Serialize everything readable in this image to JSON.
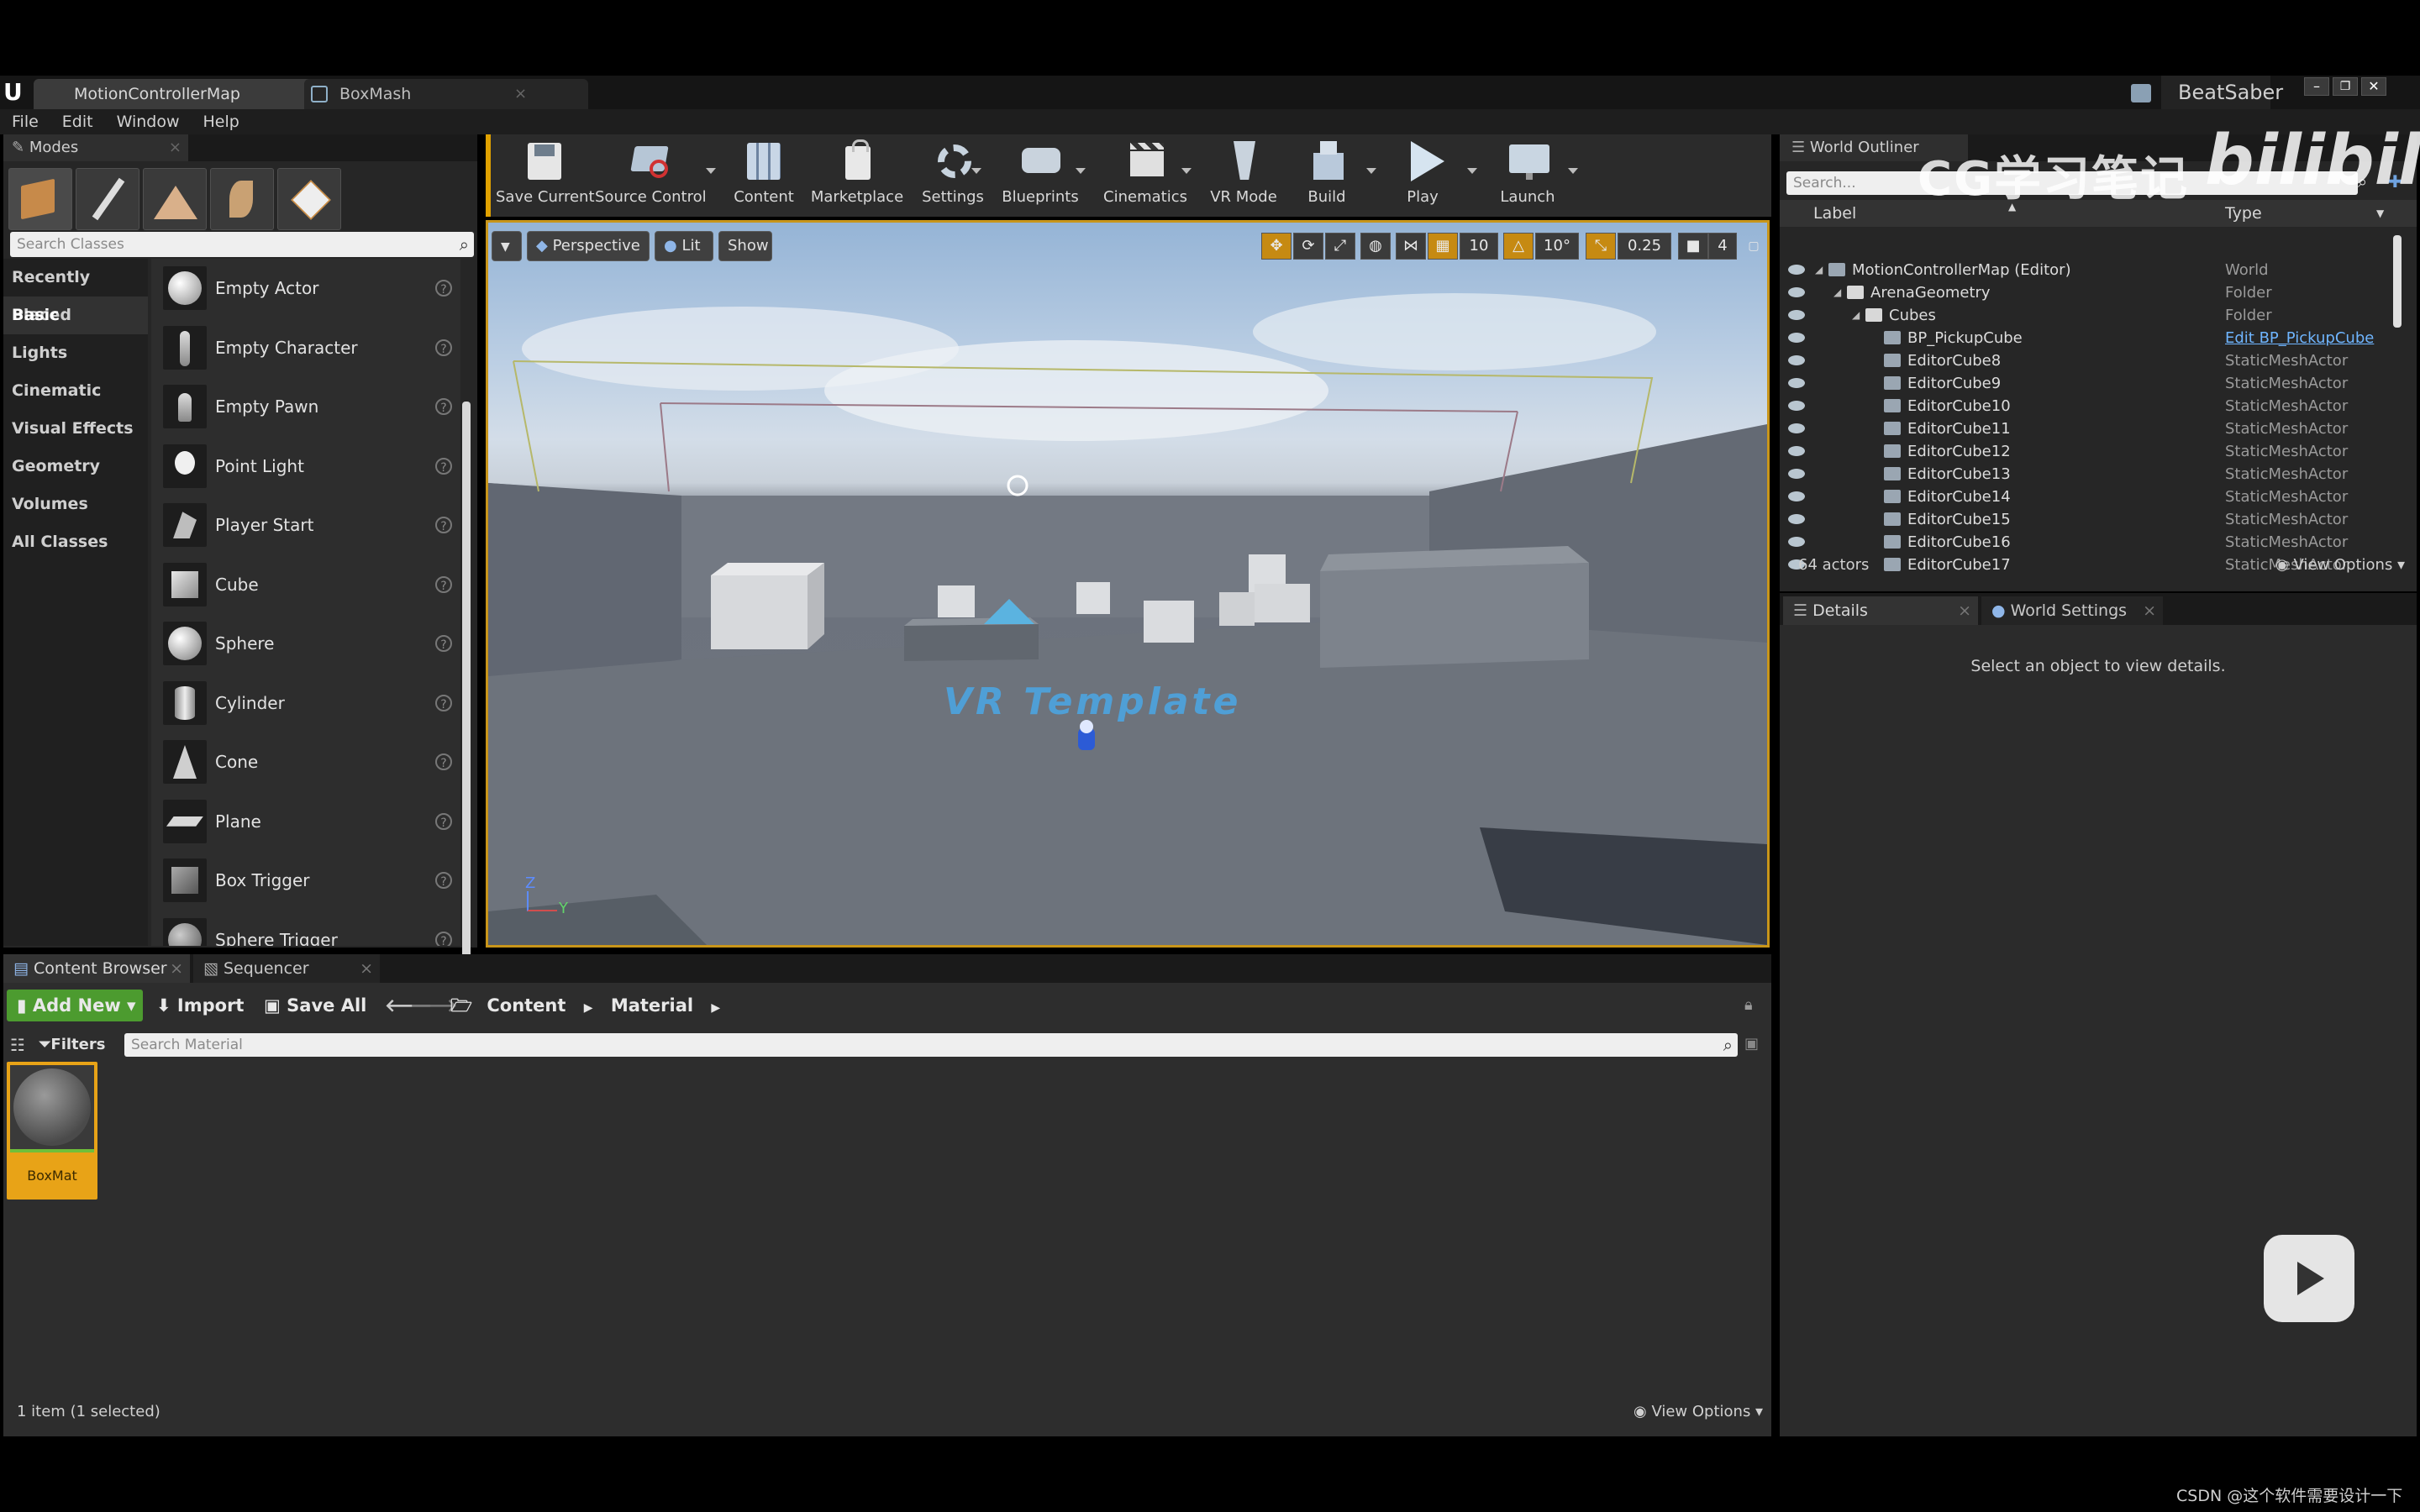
{
  "titlebar": {
    "tabs": [
      {
        "label": "MotionControllerMap"
      },
      {
        "label": "BoxMash"
      }
    ],
    "project": "BeatSaber"
  },
  "menu": [
    "File",
    "Edit",
    "Window",
    "Help"
  ],
  "modes": {
    "tab": "Modes",
    "search_placeholder": "Search Classes",
    "categories": [
      "Recently Placed",
      "Basic",
      "Lights",
      "Cinematic",
      "Visual Effects",
      "Geometry",
      "Volumes",
      "All Classes"
    ],
    "selected_category": "Basic",
    "classes": [
      "Empty Actor",
      "Empty Character",
      "Empty Pawn",
      "Point Light",
      "Player Start",
      "Cube",
      "Sphere",
      "Cylinder",
      "Cone",
      "Plane",
      "Box Trigger",
      "Sphere Trigger"
    ],
    "help_glyph": "?"
  },
  "toolbar": {
    "buttons": [
      "Save Current",
      "Source Control",
      "Content",
      "Marketplace",
      "Settings",
      "Blueprints",
      "Cinematics",
      "VR Mode",
      "Build",
      "Play",
      "Launch"
    ]
  },
  "viewport": {
    "view_mode": "Perspective",
    "lighting": "Lit",
    "show": "Show",
    "grid_snap": "10",
    "rot_snap": "10°",
    "scale_snap": "0.25",
    "cam_speed": "4",
    "scene_text": "VR Template",
    "axis_z": "Z",
    "axis_y": "Y"
  },
  "outliner": {
    "tab": "World Outliner",
    "search_placeholder": "Search...",
    "col_label": "Label",
    "col_type": "Type",
    "rows": [
      {
        "label": "MotionControllerMap (Editor)",
        "type": "World",
        "depth": 0
      },
      {
        "label": "ArenaGeometry",
        "type": "Folder",
        "depth": 1
      },
      {
        "label": "Cubes",
        "type": "Folder",
        "depth": 2
      },
      {
        "label": "BP_PickupCube",
        "type": "Edit BP_PickupCube",
        "depth": 3
      },
      {
        "label": "EditorCube8",
        "type": "StaticMeshActor",
        "depth": 3
      },
      {
        "label": "EditorCube9",
        "type": "StaticMeshActor",
        "depth": 3
      },
      {
        "label": "EditorCube10",
        "type": "StaticMeshActor",
        "depth": 3
      },
      {
        "label": "EditorCube11",
        "type": "StaticMeshActor",
        "depth": 3
      },
      {
        "label": "EditorCube12",
        "type": "StaticMeshActor",
        "depth": 3
      },
      {
        "label": "EditorCube13",
        "type": "StaticMeshActor",
        "depth": 3
      },
      {
        "label": "EditorCube14",
        "type": "StaticMeshActor",
        "depth": 3
      },
      {
        "label": "EditorCube15",
        "type": "StaticMeshActor",
        "depth": 3
      },
      {
        "label": "EditorCube16",
        "type": "StaticMeshActor",
        "depth": 3
      },
      {
        "label": "EditorCube17",
        "type": "StaticMeshActor",
        "depth": 3
      }
    ],
    "actor_count": "64 actors",
    "view_options": "View Options"
  },
  "details": {
    "tabs": [
      "Details",
      "World Settings"
    ],
    "empty_text": "Select an object to view details."
  },
  "content_browser": {
    "tabs": [
      "Content Browser",
      "Sequencer"
    ],
    "add_new": "Add New",
    "import": "Import",
    "save_all": "Save All",
    "path": [
      "Content",
      "Material"
    ],
    "filters": "Filters",
    "search_placeholder": "Search Material",
    "asset_name": "BoxMat",
    "status": "1 item (1 selected)",
    "view_options": "View Options"
  },
  "watermark": {
    "cg": "CG学习笔记",
    "bili": "bilibili",
    "csdn": "CSDN @这个软件需要设计一下"
  },
  "colors": {
    "accent": "#e0a100",
    "add_new": "#4c9b2f",
    "link": "#6fb5ff"
  }
}
